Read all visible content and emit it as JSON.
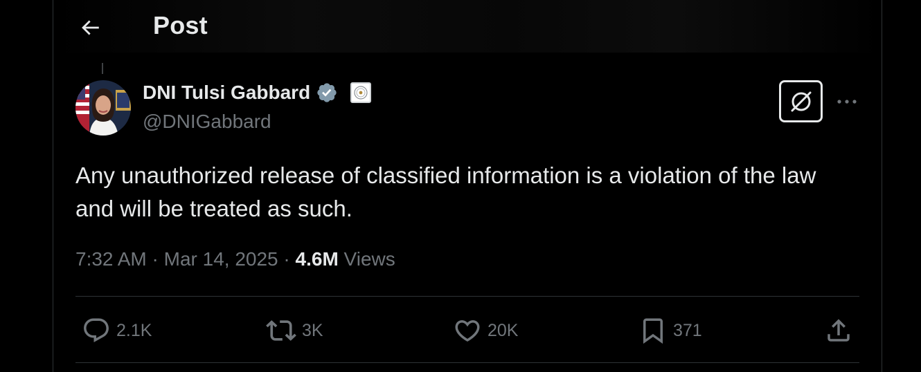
{
  "header": {
    "title": "Post"
  },
  "post": {
    "author_name": "DNI Tulsi Gabbard",
    "handle": "@DNIGabbard",
    "text": "Any unauthorized release of classified information is a violation of the law and will be treated as such.",
    "time": "7:32 AM",
    "separator": "·",
    "date": "Mar 14, 2025",
    "views_count": "4.6M",
    "views_label": "Views"
  },
  "actions": {
    "replies": "2.1K",
    "reposts": "3K",
    "likes": "20K",
    "bookmarks": "371"
  },
  "icons": [
    "back-arrow-icon",
    "verified-badge-icon",
    "affiliation-badge-icon",
    "grok-icon",
    "more-icon",
    "reply-icon",
    "repost-icon",
    "like-icon",
    "bookmark-icon",
    "share-icon"
  ],
  "colors": {
    "background": "#000000",
    "text": "#e7e9ea",
    "muted": "#71767b",
    "verified": "#829aab",
    "border": "#2f3336"
  }
}
